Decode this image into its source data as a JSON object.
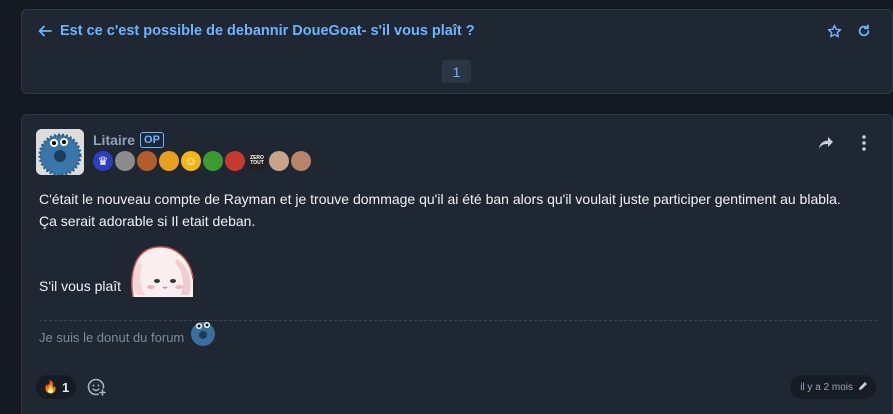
{
  "topic": {
    "title": "Est ce c'est possible de debannir DoueGoat- s'il vous plaît ?",
    "back_icon": "arrow-left-icon",
    "favorite_icon": "star-icon",
    "refresh_icon": "refresh-icon",
    "pages": [
      "1"
    ],
    "current_page": "1"
  },
  "post": {
    "author": "Litaire",
    "op_badge": "OP",
    "badges": [
      {
        "name": "crown-badge",
        "color": "#2c3fbf",
        "text": "♛"
      },
      {
        "name": "portrait-badge-1",
        "color": "#8c8c8c",
        "text": ""
      },
      {
        "name": "portrait-badge-2",
        "color": "#b25d2a",
        "text": ""
      },
      {
        "name": "rainbow-badge",
        "color": "#e8a020",
        "text": ""
      },
      {
        "name": "smiley-badge",
        "color": "#f2b51a",
        "text": "☺"
      },
      {
        "name": "beer-badge",
        "color": "#3d9a32",
        "text": ""
      },
      {
        "name": "lips-badge",
        "color": "#c63a2e",
        "text": ""
      },
      {
        "name": "zero-tout-badge",
        "color": "#222222",
        "text": "ZERO TOUT"
      },
      {
        "name": "face-badge",
        "color": "#c8a58a",
        "text": ""
      },
      {
        "name": "frame-badge",
        "color": "#b8846a",
        "text": ""
      }
    ],
    "share_icon": "share-icon",
    "more_icon": "more-vertical-icon",
    "lines": [
      "C'était le nouveau compte de Rayman et je trouve dommage qu'il ai été ban alors qu'il voulait juste participer gentiment au blabla.",
      "Ça serait adorable si Il etait deban."
    ],
    "closing": "S'il vous plaît",
    "signature": "Je suis le donut du forum",
    "reaction": {
      "emoji": "🔥",
      "count": "1"
    },
    "add_reaction_icon": "add-reaction-icon",
    "timestamp": "il y a 2 mois",
    "edit_icon": "pencil-icon"
  },
  "colors": {
    "accent": "#6fb3ff",
    "background": "#141a21",
    "card": "#1f2733"
  }
}
